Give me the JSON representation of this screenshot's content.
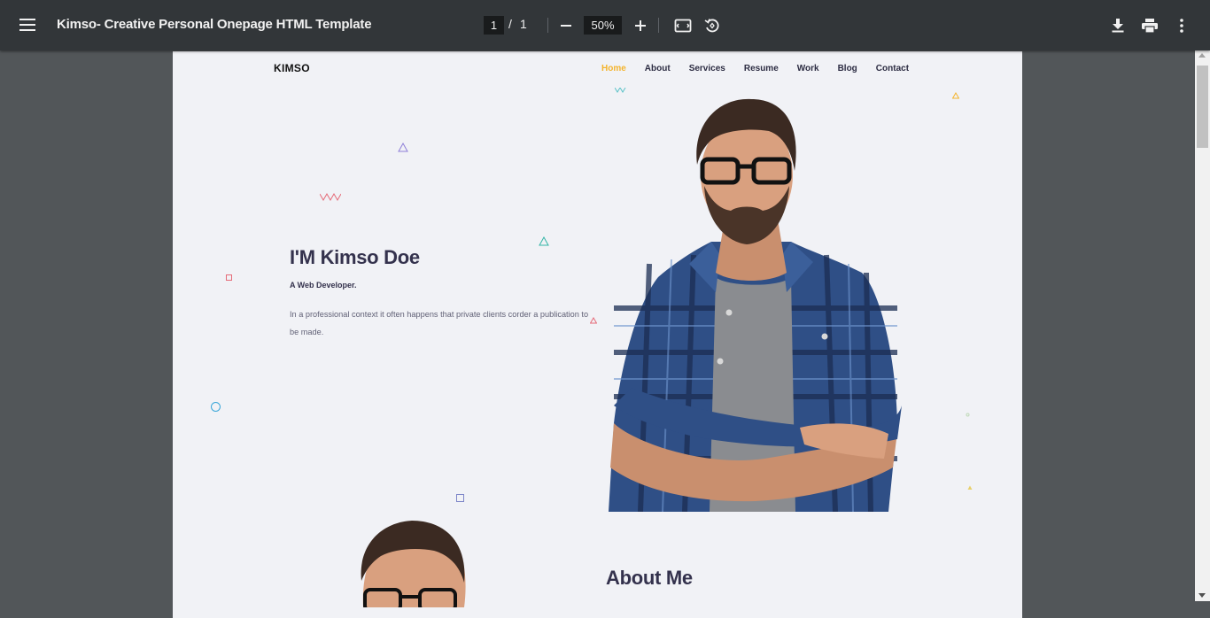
{
  "viewer": {
    "title": "Kimso- Creative Personal Onepage HTML Template",
    "current_page": "1",
    "separator": "/",
    "total_pages": "1",
    "zoom": "50%"
  },
  "site": {
    "logo": "KIMSO",
    "nav": [
      {
        "label": "Home",
        "active": true
      },
      {
        "label": "About",
        "active": false
      },
      {
        "label": "Services",
        "active": false
      },
      {
        "label": "Resume",
        "active": false
      },
      {
        "label": "Work",
        "active": false
      },
      {
        "label": "Blog",
        "active": false
      },
      {
        "label": "Contact",
        "active": false
      }
    ],
    "hero": {
      "title": "I'M Kimso Doe",
      "subtitle": "A Web Developer.",
      "description": "In a professional context it often happens that private clients corder a publication to be made."
    },
    "about": {
      "title": "About Me"
    }
  },
  "colors": {
    "accent": "#f4b42d",
    "heading": "#34324d",
    "toolbar": "#323639",
    "page_bg": "#f1f2f6"
  }
}
